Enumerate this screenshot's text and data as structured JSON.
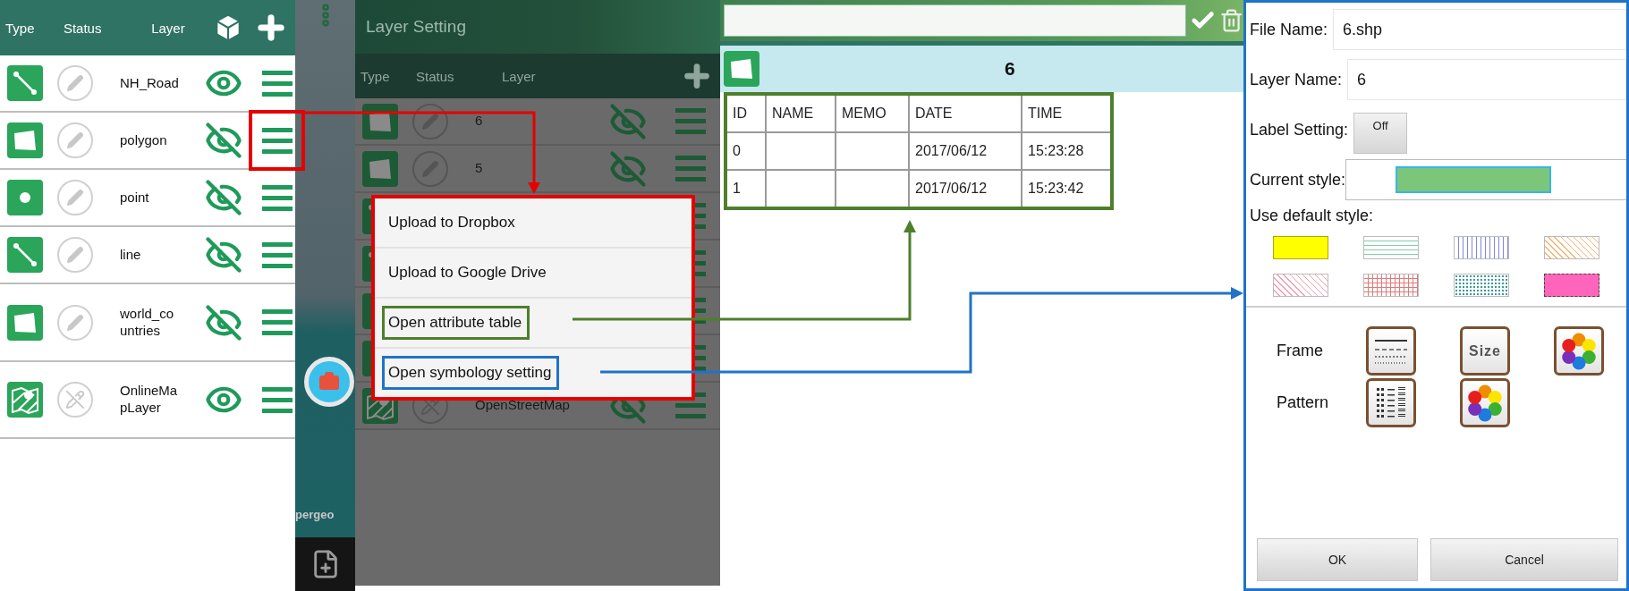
{
  "layer_list": {
    "columns": [
      "Type",
      "Status",
      "Layer"
    ],
    "layers": [
      {
        "kind": "line",
        "name": "NH_Road",
        "editable": true,
        "visible": true,
        "marked": false
      },
      {
        "kind": "polygon",
        "name": "polygon",
        "editable": true,
        "visible": false,
        "marked": true
      },
      {
        "kind": "point",
        "name": "point",
        "editable": true,
        "visible": false,
        "marked": false
      },
      {
        "kind": "line",
        "name": "line",
        "editable": true,
        "visible": false,
        "marked": false
      },
      {
        "kind": "polygon",
        "name": "world_countries",
        "editable": true,
        "visible": false,
        "marked": false
      },
      {
        "kind": "map",
        "name": "OnlineMapLayer",
        "editable": false,
        "visible": true,
        "marked": false
      }
    ]
  },
  "map": {
    "attribution": "pergeo"
  },
  "layer_setting": {
    "title": "Layer Setting",
    "columns": [
      "Type",
      "Status",
      "Layer"
    ],
    "layers": [
      {
        "kind": "polygon",
        "name": "6",
        "editable": true,
        "visible": false
      },
      {
        "kind": "polygon",
        "name": "5",
        "editable": true,
        "visible": false
      },
      {
        "kind": "line"
      },
      {
        "kind": "line"
      },
      {
        "kind": "point"
      },
      {
        "kind": "point"
      },
      {
        "kind": "map",
        "name": "OpenStreetMap",
        "editable": false,
        "visible": false
      }
    ],
    "menu": [
      {
        "label": "Upload to Dropbox"
      },
      {
        "label": "Upload to Google Drive"
      },
      {
        "label": "Open attribute table",
        "color": "#4e7f2c"
      },
      {
        "label": "Open symbology setting",
        "color": "#1f73c8"
      }
    ]
  },
  "attribute_table": {
    "title": {
      "kind": "polygon",
      "text": "6"
    },
    "columns": [
      "ID",
      "NAME",
      "MEMO",
      "DATE",
      "TIME"
    ],
    "rows": [
      {
        "id": "0",
        "date": "2017/06/12",
        "time": "15:23:28"
      },
      {
        "id": "1",
        "date": "2017/06/12",
        "time": "15:23:42"
      }
    ]
  },
  "symbology": {
    "fields": [
      {
        "label": "File Name:",
        "value": "6.shp"
      },
      {
        "label": "Layer Name:",
        "value": "6"
      }
    ],
    "label_setting": {
      "label": "Label Setting:",
      "button": "Off"
    },
    "current_style": {
      "label": "Current style:",
      "color": "#7bc67b"
    },
    "default_style": {
      "label": "Use default style:",
      "swatches": [
        {
          "kind": "solid",
          "color": "#ffff00"
        },
        {
          "kind": "hlines",
          "color": "#7fcfa8"
        },
        {
          "kind": "vlines",
          "color": "#7f86e0"
        },
        {
          "kind": "diagonal",
          "color": "#f0b878"
        },
        {
          "kind": "diagonal",
          "color": "#f0a0b4"
        },
        {
          "kind": "grid",
          "color": "#e07a7a"
        },
        {
          "kind": "dots",
          "color": "#3a9a9a"
        },
        {
          "kind": "dashed",
          "color": "#ff66bb"
        }
      ]
    },
    "tools": [
      {
        "label": "Frame",
        "buttons": [
          {
            "kind": "lines"
          },
          {
            "kind": "text",
            "text": "Size"
          },
          {
            "kind": "colors"
          }
        ]
      },
      {
        "label": "Pattern",
        "buttons": [
          {
            "kind": "pattern"
          },
          {
            "kind": "colors"
          }
        ]
      }
    ],
    "buttons": [
      "OK",
      "Cancel"
    ]
  }
}
